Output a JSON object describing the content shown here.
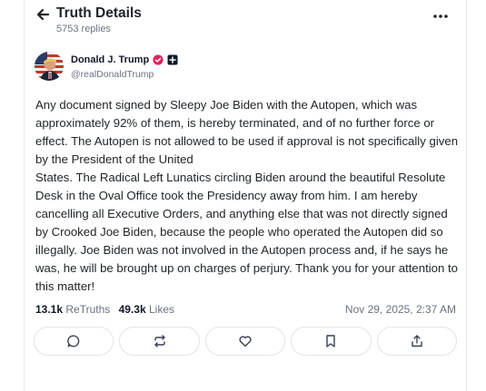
{
  "header": {
    "title": "Truth Details",
    "replies": "5753 replies"
  },
  "author": {
    "name": "Donald J. Trump",
    "handle": "@realDonaldTrump",
    "verified_color": "#e0245e"
  },
  "post": {
    "text": "Any document signed by Sleepy Joe Biden with the Autopen, which was approximately 92% of them, is hereby terminated, and of no further force or effect. The Autopen is not allowed to be used if approval is not specifically given by the President of the United\nStates. The Radical Left Lunatics circling Biden around the beautiful Resolute Desk in the Oval Office took the Presidency away from him. I am hereby cancelling all Executive Orders, and anything else that was not directly signed by Crooked Joe Biden, because the people who operated the Autopen did so illegally. Joe Biden was not involved in the Autopen process and, if he says he was, he will be brought up on charges of perjury. Thank you for your attention to this matter!"
  },
  "stats": {
    "retruths_count": "13.1k",
    "retruths_label": "ReTruths",
    "likes_count": "49.3k",
    "likes_label": "Likes",
    "date": "Nov 29, 2025, 2:37 AM"
  },
  "actions": {
    "icons": [
      "reply-icon",
      "retruth-icon",
      "like-icon",
      "bookmark-icon",
      "share-icon"
    ]
  }
}
